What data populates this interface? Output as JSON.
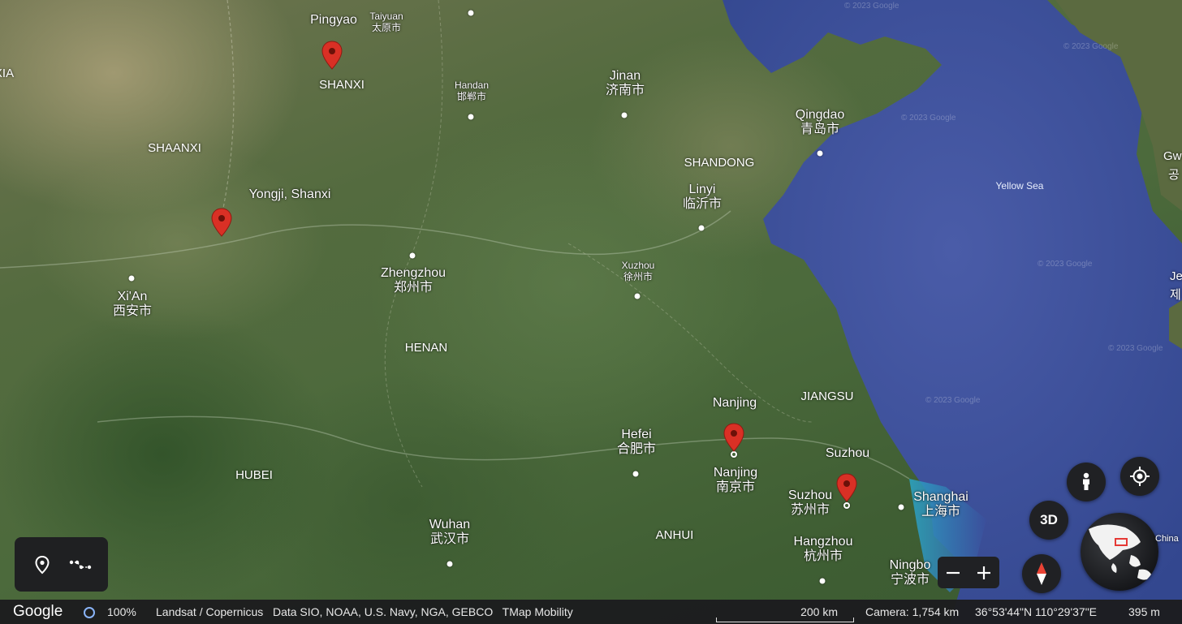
{
  "map": {
    "places": [
      {
        "key": "pingyao",
        "en": "Pingyao",
        "zh": ""
      },
      {
        "key": "taiyuan",
        "en": "Taiyuan",
        "zh": "太原市"
      },
      {
        "key": "handan",
        "en": "Handan",
        "zh": "邯郸市"
      },
      {
        "key": "jinan",
        "en": "Jinan",
        "zh": "济南市"
      },
      {
        "key": "qingdao",
        "en": "Qingdao",
        "zh": "青岛市"
      },
      {
        "key": "linyi",
        "en": "Linyi",
        "zh": "临沂市"
      },
      {
        "key": "yongji",
        "en": "Yongji, Shanxi",
        "zh": ""
      },
      {
        "key": "xian",
        "en": "Xi'An",
        "zh": "西安市"
      },
      {
        "key": "zhengzhou",
        "en": "Zhengzhou",
        "zh": "郑州市"
      },
      {
        "key": "xuzhou",
        "en": "Xuzhou",
        "zh": "徐州市"
      },
      {
        "key": "nanjing_pin",
        "en": "Nanjing",
        "zh": ""
      },
      {
        "key": "hefei",
        "en": "Hefei",
        "zh": "合肥市"
      },
      {
        "key": "nanjing",
        "en": "Nanjing",
        "zh": "南京市"
      },
      {
        "key": "suzhou_pin",
        "en": "Suzhou",
        "zh": ""
      },
      {
        "key": "suzhou",
        "en": "Suzhou",
        "zh": "苏州市"
      },
      {
        "key": "shanghai",
        "en": "Shanghai",
        "zh": "上海市"
      },
      {
        "key": "hangzhou",
        "en": "Hangzhou",
        "zh": "杭州市"
      },
      {
        "key": "ningbo",
        "en": "Ningbo",
        "zh": "宁波市"
      },
      {
        "key": "wuhan",
        "en": "Wuhan",
        "zh": "武汉市"
      }
    ],
    "provinces": {
      "shanxi": "SHANXI",
      "shaanxi": "SHAANXI",
      "shandong": "SHANDONG",
      "henan": "HENAN",
      "jiangsu": "JIANGSU",
      "anhui": "ANHUI",
      "hubei": "HUBEI",
      "edge": "XIA"
    },
    "sea": "Yellow Sea",
    "edge_right": [
      "Gw",
      "공",
      "Je",
      "제"
    ],
    "watermark": "© 2023 Google"
  },
  "controls": {
    "btn_3d": "3D",
    "globe_label": "China"
  },
  "status_bar": {
    "logo": "Google",
    "zoom_pct": "100%",
    "attribution": "Landsat / Copernicus   Data SIO, NOAA, U.S. Navy, NGA, GEBCO   TMap Mobility",
    "scale": "200 km",
    "camera": "Camera: 1,754 km",
    "coords": "36°53'44\"N 110°29'37\"E",
    "elevation": "395 m"
  },
  "colors": {
    "pin": "#d93025",
    "sea": "#3b4f9c",
    "panel": "#202124",
    "accent": "#8ab4f8"
  }
}
